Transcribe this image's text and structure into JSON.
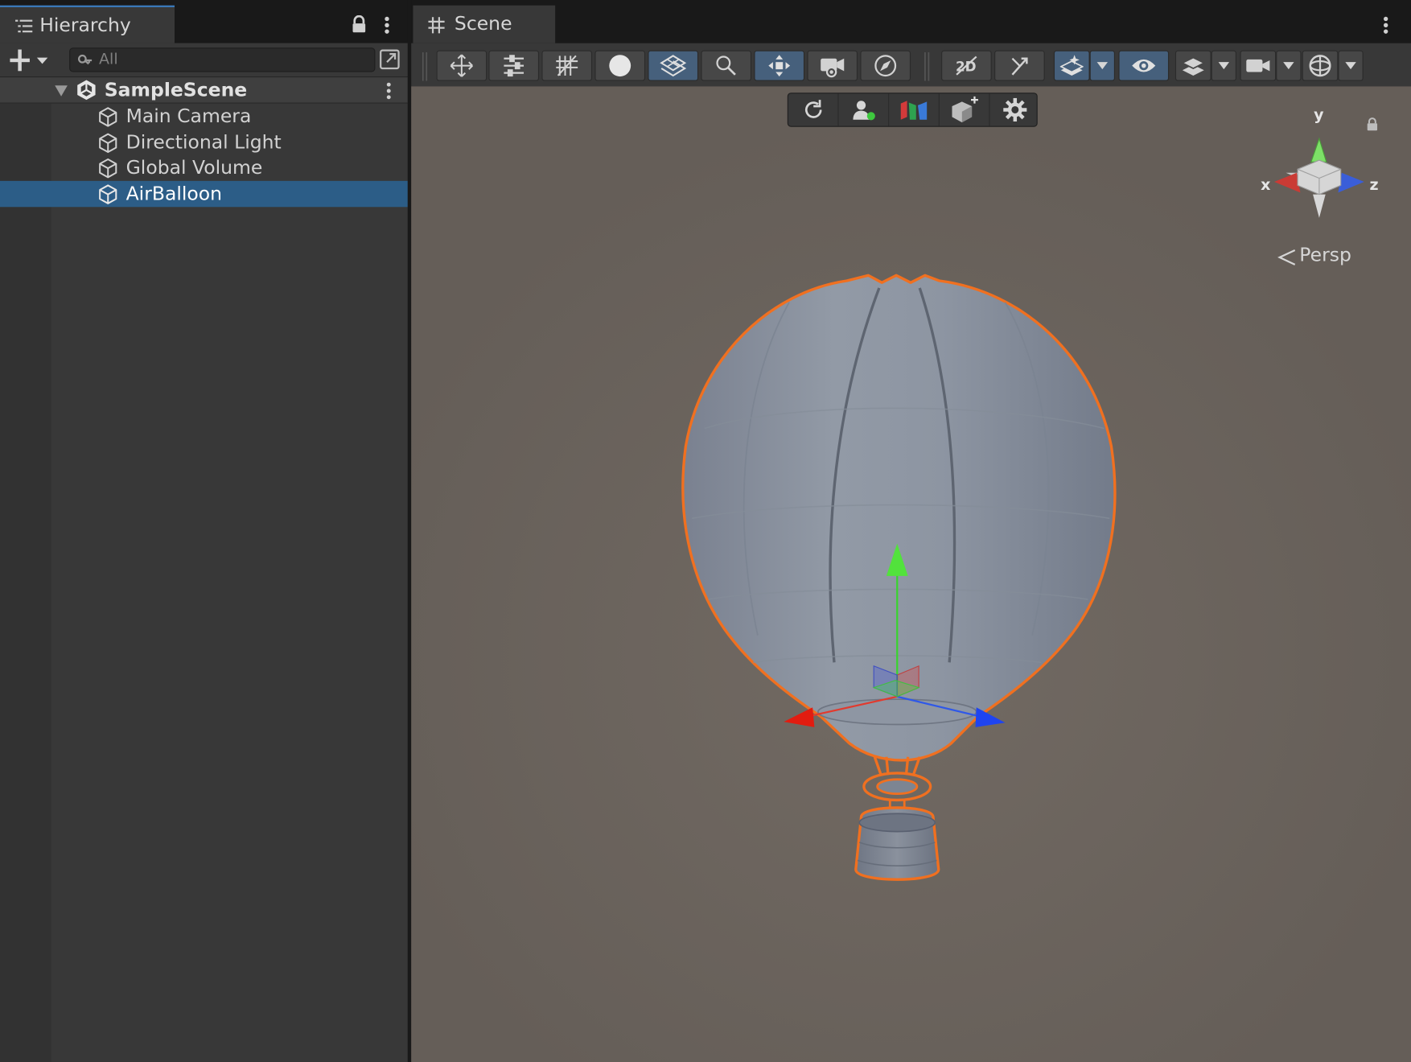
{
  "hierarchy": {
    "tab_label": "Hierarchy",
    "search_placeholder": "All",
    "scene_name": "SampleScene",
    "items": [
      {
        "label": "Main Camera"
      },
      {
        "label": "Directional Light"
      },
      {
        "label": "Global Volume"
      },
      {
        "label": "AirBalloon",
        "selected": true
      }
    ]
  },
  "scene": {
    "tab_label": "Scene",
    "projection_label": "Persp",
    "gizmo_axes": {
      "x": "x",
      "y": "y",
      "z": "z"
    },
    "toolbar_icons": [
      "move-tool-icon",
      "snapping-icon",
      "grid-snap-icon",
      "shading-sphere-icon",
      "grid-toggle-icon",
      "search-icon",
      "center-pivot-icon",
      "camera-view-icon",
      "orientation-icon",
      "2d-toggle-icon",
      "lighting-toggle-icon",
      "effects-icon",
      "visibility-icon",
      "layers-icon",
      "camera-settings-icon",
      "gizmos-icon"
    ],
    "overlay_icons": [
      "refresh-icon",
      "user-icon",
      "unity-logo-icon",
      "add-object-icon",
      "settings-icon"
    ],
    "selected_outline_color": "#f07020"
  }
}
